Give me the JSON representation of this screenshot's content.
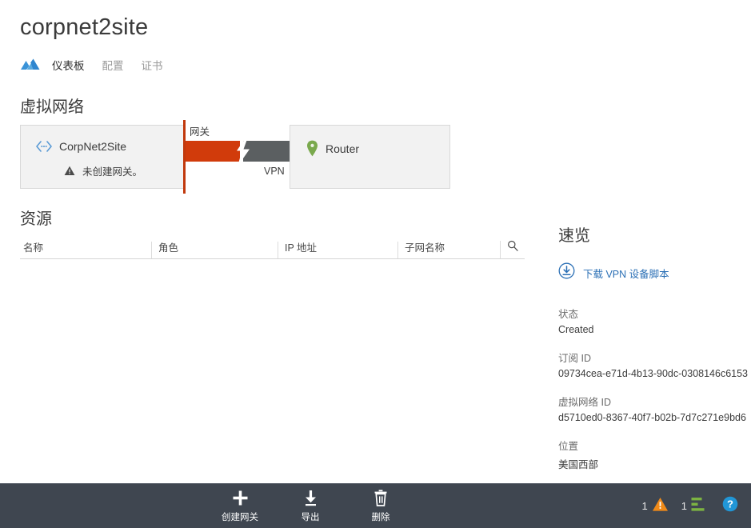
{
  "header": {
    "title": "corpnet2site"
  },
  "tabs": {
    "logo_icon": "azure-cloud-icon",
    "items": [
      {
        "label": "仪表板",
        "active": true
      },
      {
        "label": "配置",
        "active": false
      },
      {
        "label": "证书",
        "active": false
      }
    ]
  },
  "sections": {
    "virtual_network": "虚拟网络",
    "resources": "资源"
  },
  "diagram": {
    "left_node": {
      "icon": "virtual-network-icon",
      "name": "CorpNet2Site",
      "warning_icon": "warning-triangle-icon",
      "warning_text": "未创建网关。"
    },
    "connector": {
      "gateway_label": "网关",
      "vpn_label": "VPN",
      "status_icon": "broken-link-bolt-icon",
      "color_left": "#d13b0b",
      "color_right": "#5b5f61",
      "accent_line": "#c1390d"
    },
    "right_node": {
      "icon": "map-pin-icon",
      "name": "Router"
    }
  },
  "resources_table": {
    "columns": [
      "名称",
      "角色",
      "IP 地址",
      "子网名称"
    ],
    "search_icon": "search-icon",
    "rows": []
  },
  "quick_glance": {
    "title": "速览",
    "download_icon": "download-circle-icon",
    "download_label": "下载 VPN 设备脚本",
    "fields": [
      {
        "key": "状态",
        "value": "Created"
      },
      {
        "key": "订阅 ID",
        "value": "09734cea-e71d-4b13-90dc-0308146c6153"
      },
      {
        "key": "虚拟网络 ID",
        "value": "d5710ed0-8367-40f7-b02b-7d7c271e9bd6"
      },
      {
        "key": "位置",
        "value": "美国西部"
      }
    ]
  },
  "toolbar": {
    "actions": [
      {
        "icon": "plus-icon",
        "label": "创建网关"
      },
      {
        "icon": "download-icon",
        "label": "导出"
      },
      {
        "icon": "trash-icon",
        "label": "删除"
      }
    ],
    "status": {
      "warning_count": "1",
      "warning_icon": "warning-triangle-icon",
      "jobs_count": "1",
      "jobs_icon": "operations-list-icon",
      "help_icon": "help-circle-icon",
      "warning_color": "#f08a18",
      "jobs_color": "#7cb342",
      "help_color": "#2196d6"
    },
    "background_color": "#3f4650"
  }
}
